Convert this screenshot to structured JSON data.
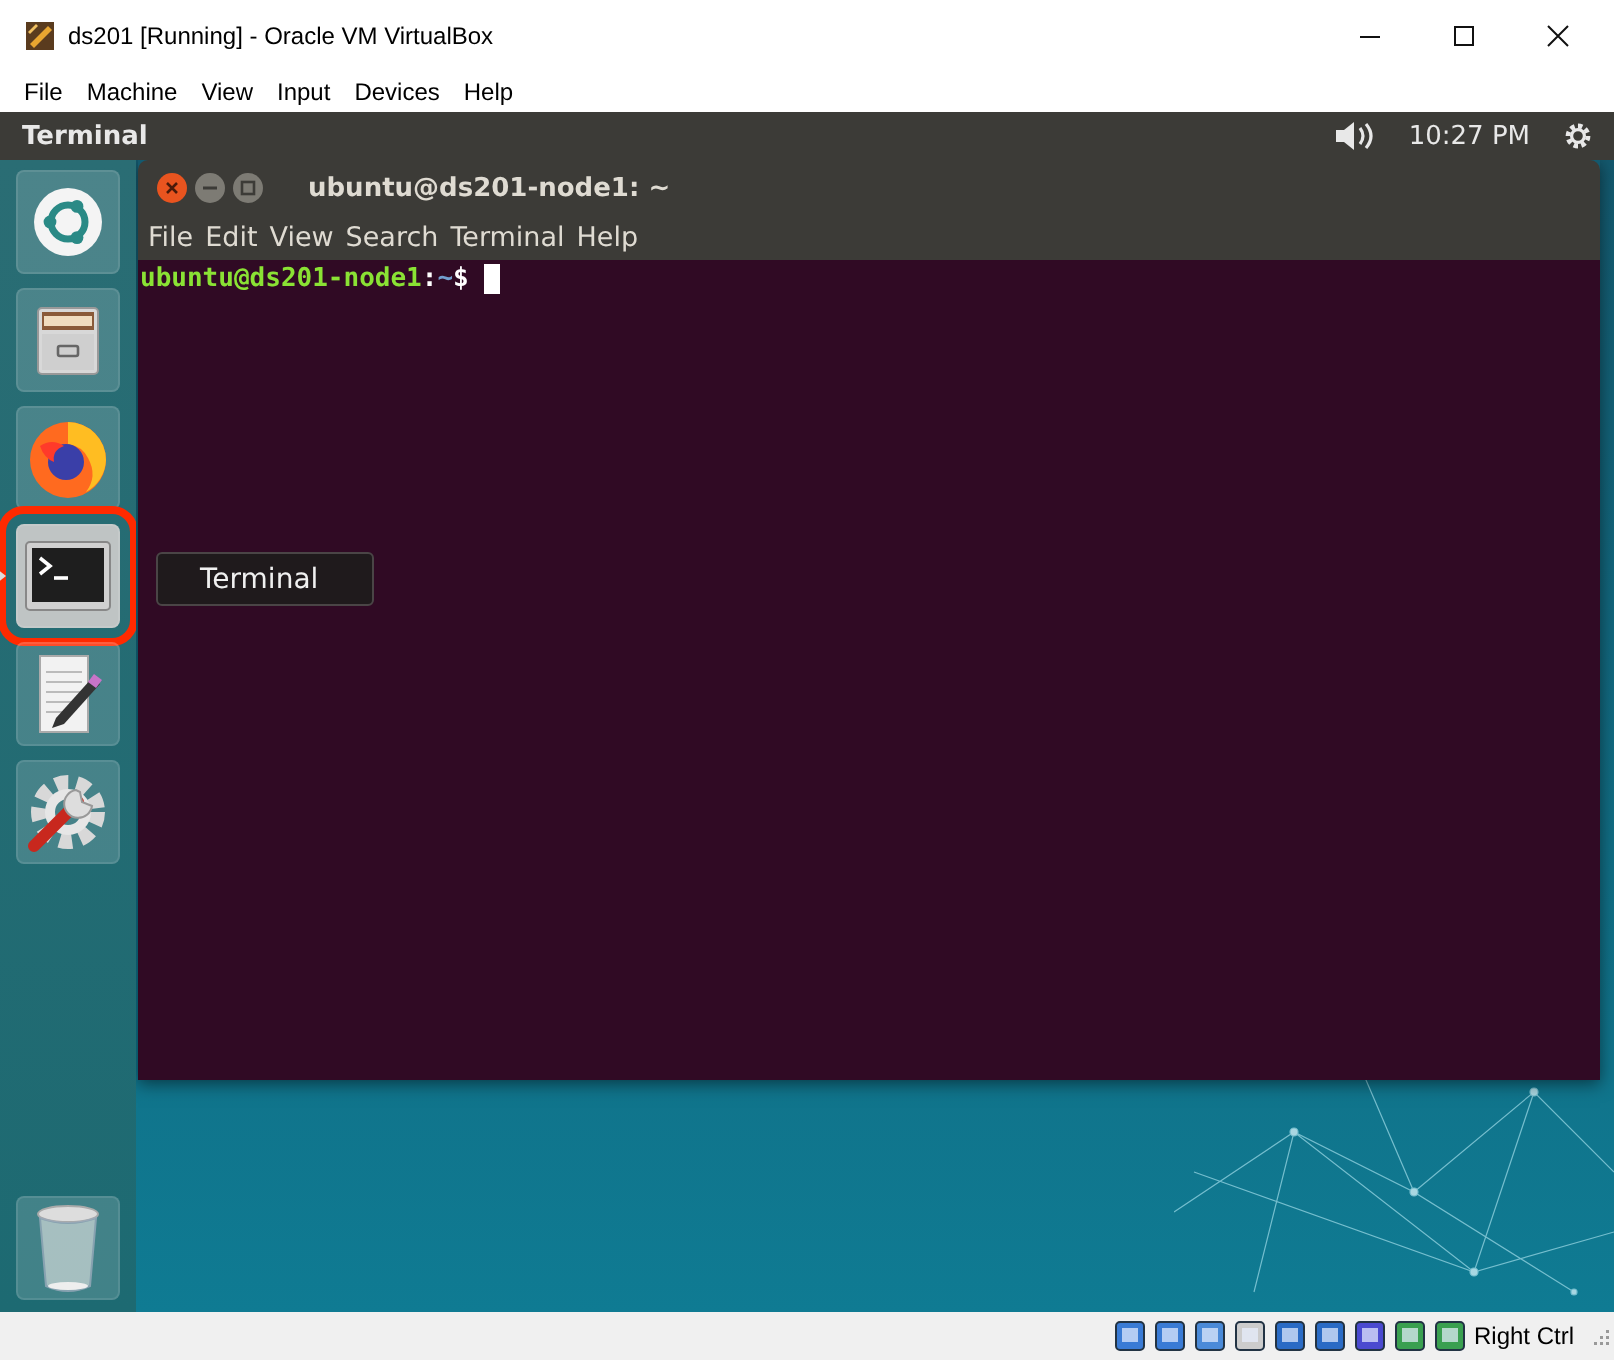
{
  "window": {
    "title": "ds201 [Running] - Oracle VM VirtualBox"
  },
  "menu": [
    "File",
    "Machine",
    "View",
    "Input",
    "Devices",
    "Help"
  ],
  "top_bar": {
    "app_name": "Terminal",
    "time": "10:27 PM"
  },
  "launcher": {
    "items": [
      {
        "kind": "ubuntu",
        "selected": false
      },
      {
        "kind": "files",
        "selected": false
      },
      {
        "kind": "firefox",
        "selected": false
      },
      {
        "kind": "terminal",
        "selected": true
      },
      {
        "kind": "editor",
        "selected": false
      },
      {
        "kind": "settings",
        "selected": false
      }
    ],
    "trash": {
      "kind": "trash"
    }
  },
  "tooltip": "Terminal",
  "terminal": {
    "title": "ubuntu@ds201-node1: ~",
    "menu": [
      "File",
      "Edit",
      "View",
      "Search",
      "Terminal",
      "Help"
    ],
    "prompt": {
      "user_host": "ubuntu@ds201-node1",
      "separator": ":",
      "path": "~",
      "symbol": "$"
    }
  },
  "status_bar": {
    "host_key": "Right Ctrl"
  }
}
